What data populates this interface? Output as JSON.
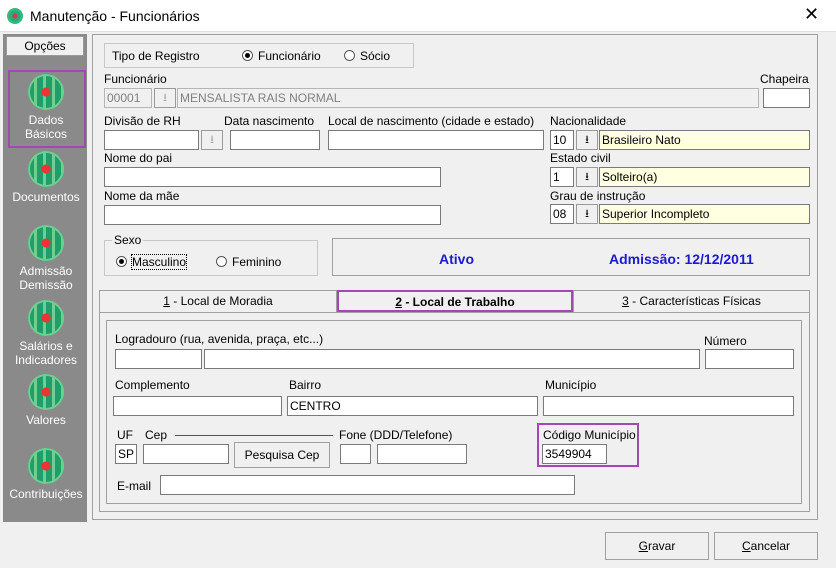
{
  "window": {
    "title": "Manutenção - Funcionários",
    "close": "✕"
  },
  "sidebar": {
    "options_label": "Opções",
    "items": [
      {
        "label": "Dados Básicos"
      },
      {
        "label": "Documentos"
      },
      {
        "label": "Admissão Demissão"
      },
      {
        "label": "Salários e Indicadores"
      },
      {
        "label": "Valores"
      },
      {
        "label": "Contribuições"
      }
    ]
  },
  "registro": {
    "label": "Tipo de Registro",
    "opt1": "Funcionário",
    "opt2": "Sócio"
  },
  "funcionario": {
    "label": "Funcionário",
    "code": "00001",
    "name": "MENSALISTA RAIS  NORMAL"
  },
  "chapeira": {
    "label": "Chapeira",
    "value": ""
  },
  "divisao": {
    "label": "Divisão de RH"
  },
  "data_nasc": {
    "label": "Data nascimento"
  },
  "local_nasc": {
    "label": "Local de nascimento (cidade e estado)"
  },
  "nacionalidade": {
    "label": "Nacionalidade",
    "code": "10",
    "value": "Brasileiro Nato"
  },
  "pai": {
    "label": "Nome do pai"
  },
  "mae": {
    "label": "Nome da mãe"
  },
  "estado_civil": {
    "label": "Estado civil",
    "code": "1",
    "value": "Solteiro(a)"
  },
  "instrucao": {
    "label": "Grau de instrução",
    "code": "08",
    "value": "Superior Incompleto"
  },
  "sexo": {
    "label": "Sexo",
    "opt1": "Masculino",
    "opt2": "Feminino"
  },
  "status": {
    "state": "Ativo",
    "admissao": "Admissão: 12/12/2011"
  },
  "tabs": [
    {
      "num": "1",
      "label": " - Local de Moradia"
    },
    {
      "num": "2",
      "label": " - Local de Trabalho"
    },
    {
      "num": "3",
      "label": " - Características Físicas"
    }
  ],
  "trabalho": {
    "logradouro_label": "Logradouro (rua, avenida, praça, etc...)",
    "numero_label": "Número",
    "complemento_label": "Complemento",
    "bairro_label": "Bairro",
    "bairro_value": "CENTRO",
    "municipio_label": "Município",
    "uf_label": "UF",
    "uf_value": "SP",
    "cep_label": "Cep",
    "pesquisa_cep": "Pesquisa Cep",
    "fone_label": "Fone (DDD/Telefone)",
    "cod_mun_label": "Código Município",
    "cod_mun_value": "3549904",
    "email_label": "E-mail"
  },
  "buttons": {
    "gravar_u": "G",
    "gravar_rest": "ravar",
    "cancelar_u": "C",
    "cancelar_rest": "ancelar"
  },
  "lookup_glyph": "⭳",
  "highlight_color": "#a04ab1"
}
